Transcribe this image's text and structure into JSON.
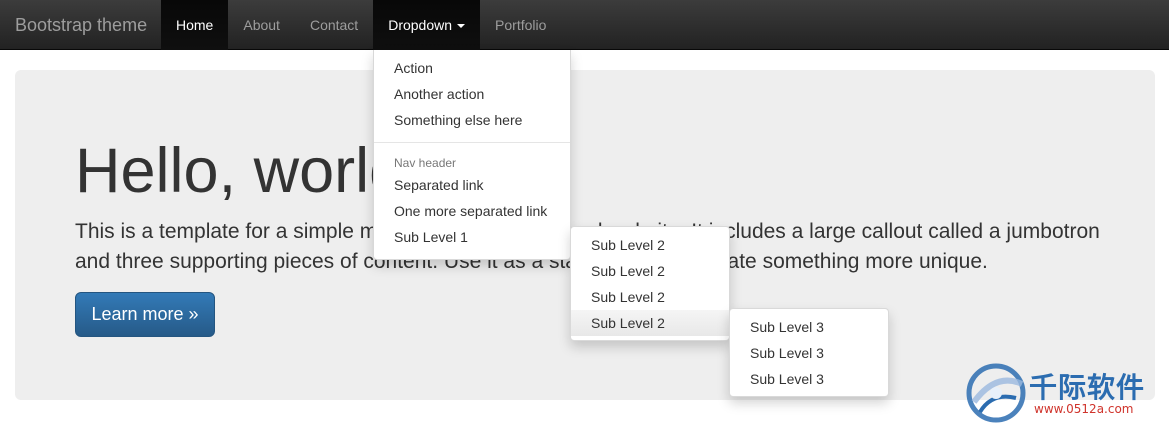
{
  "navbar": {
    "brand": "Bootstrap theme",
    "items": [
      {
        "label": "Home"
      },
      {
        "label": "About"
      },
      {
        "label": "Contact"
      },
      {
        "label": "Dropdown"
      },
      {
        "label": "Portfolio"
      }
    ]
  },
  "jumbotron": {
    "title": "Hello, world!",
    "text": "This is a template for a simple marketing or informational website. It includes a large callout called a jumbotron and three supporting pieces of content. Use it as a starting point to create something more unique.",
    "button_label": "Learn more »"
  },
  "dropdown": {
    "items_top": [
      "Action",
      "Another action",
      "Something else here"
    ],
    "header": "Nav header",
    "items_bottom": [
      "Separated link",
      "One more separated link",
      "Sub Level 1"
    ],
    "sub_level_2": [
      "Sub Level 2",
      "Sub Level 2",
      "Sub Level 2",
      "Sub Level 2"
    ],
    "sub_level_3": [
      "Sub Level 3",
      "Sub Level 3",
      "Sub Level 3"
    ]
  },
  "watermark": {
    "brand": "千际软件",
    "url": "www.0512a.com"
  },
  "colors": {
    "navbar_bg": "#222222",
    "primary": "#337ab7",
    "jumbotron_bg": "#eeeeee"
  }
}
